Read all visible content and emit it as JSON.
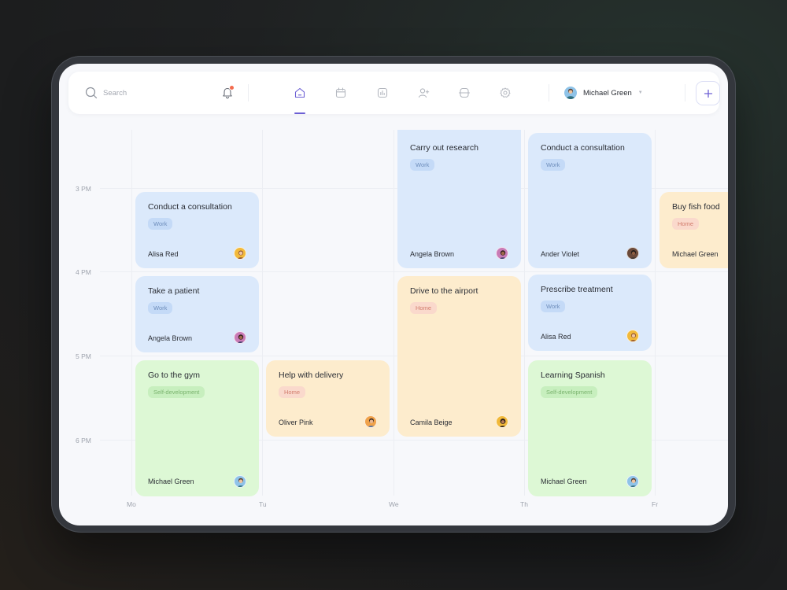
{
  "search": {
    "placeholder": "Search"
  },
  "nav": [
    {
      "name": "home-icon",
      "active": true
    },
    {
      "name": "calendar-icon",
      "active": false
    },
    {
      "name": "chart-icon",
      "active": false
    },
    {
      "name": "add-user-icon",
      "active": false
    },
    {
      "name": "transport-icon",
      "active": false
    },
    {
      "name": "settings-icon",
      "active": false
    }
  ],
  "user": {
    "name": "Michael Green"
  },
  "times": [
    "3 PM",
    "4 PM",
    "5 PM",
    "6 PM"
  ],
  "days": [
    "Mo",
    "Tu",
    "We",
    "Th",
    "Fr"
  ],
  "colors": {
    "accent": "#6c5fd4",
    "work": "#dbe9fb",
    "home": "#fdeccd",
    "self_development": "#ddf8d5",
    "notification": "#f36b4e"
  },
  "events": [
    {
      "title": "Conduct a consultation",
      "tag": "Work",
      "person": "Alisa Red"
    },
    {
      "title": "Take a patient",
      "tag": "Work",
      "person": "Angela Brown"
    },
    {
      "title": "Go to the gym",
      "tag": "Self-development",
      "person": "Michael Green"
    },
    {
      "title": "Help with delivery",
      "tag": "Home",
      "person": "Oliver Pink"
    },
    {
      "title": "Carry out research",
      "tag": "Work",
      "person": "Angela Brown"
    },
    {
      "title": "Drive to the airport",
      "tag": "Home",
      "person": "Camila Beige"
    },
    {
      "title": "Conduct a consultation",
      "tag": "Work",
      "person": "Ander Violet"
    },
    {
      "title": "Prescribe treatment",
      "tag": "Work",
      "person": "Alisa Red"
    },
    {
      "title": "Learning Spanish",
      "tag": "Self-development",
      "person": "Michael Green"
    },
    {
      "title": "Buy fish food",
      "tag": "Home",
      "person": "Michael Green"
    }
  ]
}
